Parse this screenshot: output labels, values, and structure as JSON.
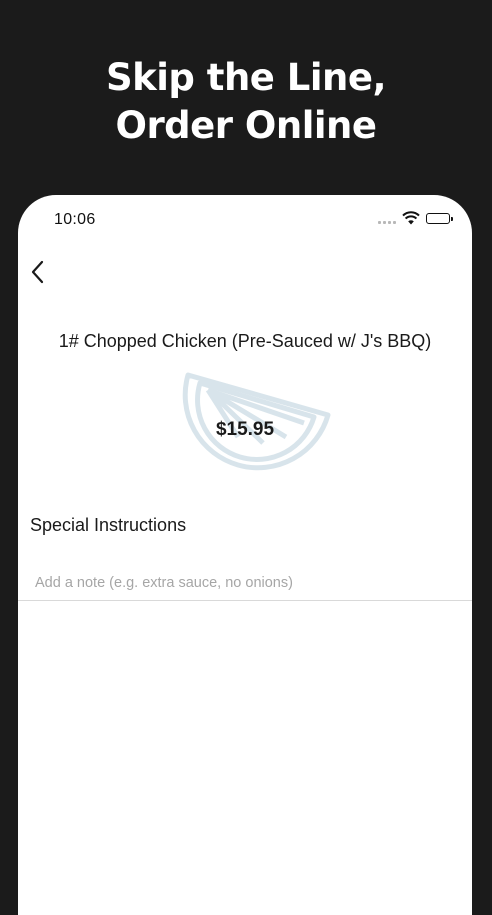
{
  "promo": {
    "line1": "Skip the Line,",
    "line2": "Order Online"
  },
  "status_bar": {
    "time": "10:06",
    "icons": [
      "signal-icon",
      "wifi-icon",
      "battery-icon"
    ]
  },
  "nav": {
    "back_icon": "chevron-left-icon"
  },
  "item": {
    "title": "1# Chopped Chicken (Pre-Sauced w/ J's BBQ)",
    "price": "$15.95"
  },
  "special_instructions": {
    "heading": "Special Instructions",
    "placeholder": "Add a note (e.g. extra sauce, no onions)",
    "value": ""
  },
  "colors": {
    "background": "#1b1b1b",
    "screen": "#ffffff",
    "text": "#1a1a1a",
    "placeholder": "#a6a6a6",
    "watermark": "#2f6f93"
  }
}
